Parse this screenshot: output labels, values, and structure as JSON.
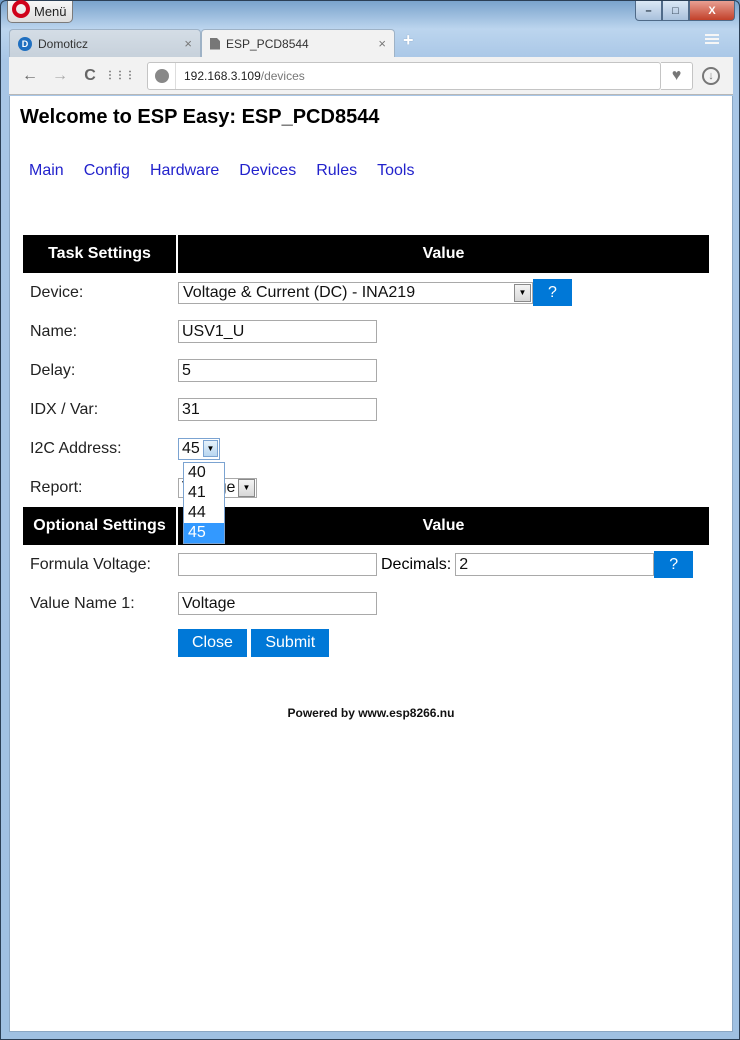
{
  "window": {
    "menu_label": "Menü",
    "controls": {
      "minimize": "–",
      "maximize": "□",
      "close": "X"
    }
  },
  "tabs": [
    {
      "label": "Domoticz",
      "icon": "domoticz-icon",
      "active": false
    },
    {
      "label": "ESP_PCD8544",
      "icon": "document-icon",
      "active": true
    }
  ],
  "toolbar": {
    "url_host": "192.168.3.109",
    "url_path": "/devices",
    "back": "←",
    "forward": "→",
    "reload": "C",
    "speed_dial": "⋮⋮⋮",
    "heart": "♥",
    "download": "↓",
    "new_tab": "+",
    "close_tab": "×"
  },
  "page": {
    "title": "Welcome to ESP Easy: ESP_PCD8544",
    "menu": [
      "Main",
      "Config",
      "Hardware",
      "Devices",
      "Rules",
      "Tools"
    ],
    "task_header": {
      "left": "Task Settings",
      "right": "Value"
    },
    "fields": {
      "device": {
        "label": "Device:",
        "value": "Voltage & Current (DC) - INA219",
        "help": "?"
      },
      "name": {
        "label": "Name:",
        "value": "USV1_U"
      },
      "delay": {
        "label": "Delay:",
        "value": "5"
      },
      "idx": {
        "label": "IDX / Var:",
        "value": "31"
      },
      "i2c": {
        "label": "I2C Address:",
        "value": "45",
        "options": [
          "40",
          "41",
          "44",
          "45"
        ],
        "selected": "45"
      },
      "report": {
        "label": "Report:",
        "value": "Voltage",
        "visible_text": "ge"
      }
    },
    "optional_header": {
      "left": "Optional Settings",
      "right": "Value"
    },
    "optional": {
      "formula": {
        "label": "Formula Voltage:",
        "value": ""
      },
      "decimals": {
        "label": "Decimals:",
        "value": "2",
        "help": "?"
      },
      "value_name": {
        "label": "Value Name 1:",
        "value": "Voltage"
      }
    },
    "buttons": {
      "close": "Close",
      "submit": "Submit"
    },
    "footer": "Powered by www.esp8266.nu"
  },
  "colors": {
    "accent": "#0078d7",
    "header_bg": "#000000",
    "link": "#2222cc",
    "selected_option": "#3399ff"
  }
}
